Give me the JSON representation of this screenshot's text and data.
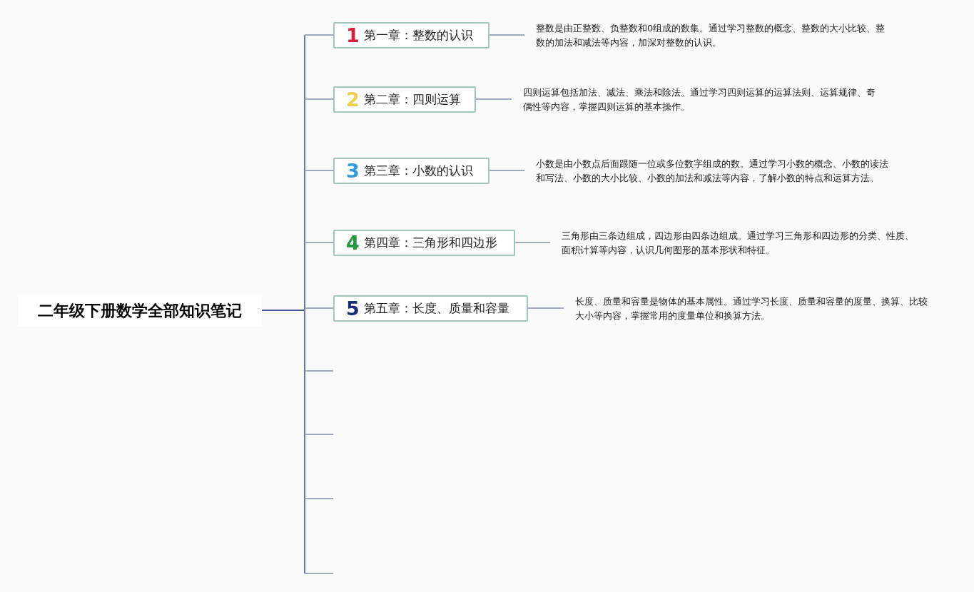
{
  "root": {
    "title": "二年级下册数学全部知识笔记"
  },
  "branches": [
    {
      "kind": "chapter",
      "number": "1",
      "color": "#d8203c",
      "title": "第一章：整数的认识",
      "note": "整数是由正整数、负整数和0组成的数集。通过学习整数的概念、整数的大小比较、整数的加法和减法等内容，加深对整数的认识。"
    },
    {
      "kind": "chapter",
      "number": "2",
      "color": "#f0d04c",
      "title": "第二章：四则运算",
      "note": "四则运算包括加法、减法、乘法和除法。通过学习四则运算的运算法则、运算规律、奇偶性等内容，掌握四则运算的基本操作。"
    },
    {
      "kind": "chapter",
      "number": "3",
      "color": "#2b9bd9",
      "title": "第三章：小数的认识",
      "note": "小数是由小数点后面跟随一位或多位数字组成的数。通过学习小数的概念、小数的读法和写法、小数的大小比较、小数的加法和减法等内容，了解小数的特点和运算方法。"
    },
    {
      "kind": "chapter",
      "number": "4",
      "color": "#20993a",
      "title": "第四章：三角形和四边形",
      "note": "三角形由三条边组成，四边形由四条边组成。通过学习三角形和四边形的分类、性质、面积计算等内容，认识几何图形的基本形状和特征。"
    },
    {
      "kind": "chapter",
      "number": "5",
      "color": "#1f2a78",
      "title": "第五章：长度、质量和容量",
      "note": "长度、质量和容量是物体的基本属性。通过学习长度、质量和容量的度量、换算、比较大小等内容，掌握常用的度量单位和换算方法。"
    },
    {
      "kind": "empty"
    },
    {
      "kind": "empty"
    },
    {
      "kind": "empty"
    },
    {
      "kind": "empty"
    }
  ]
}
